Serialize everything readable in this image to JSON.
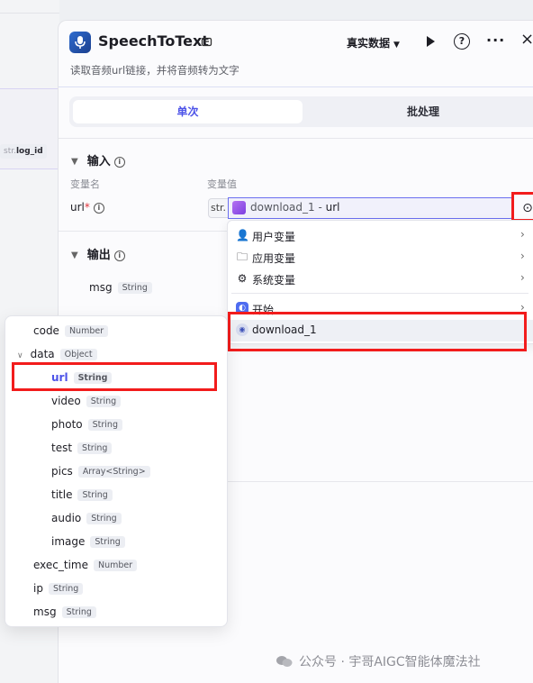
{
  "canvas": {
    "node_tag_dim": "str.",
    "node_tag_label": "log_id"
  },
  "header": {
    "title": "SpeechToText",
    "description": "读取音频url链接，并将音频转为文字",
    "env_select": "真实数据",
    "help_label": "?",
    "more_label": "···",
    "close_label": "×"
  },
  "tabs": [
    {
      "label": "单次",
      "active": true
    },
    {
      "label": "批处理",
      "active": false
    }
  ],
  "input": {
    "section_title": "输入",
    "col_name": "变量名",
    "col_value": "变量值",
    "params": [
      {
        "name": "url",
        "required_mark": "*",
        "type": "str.",
        "ref_node": "download_1",
        "ref_sep": " - ",
        "ref_field": "url"
      }
    ]
  },
  "output": {
    "section_title": "输出",
    "fields": [
      {
        "name": "msg",
        "type": "String"
      }
    ]
  },
  "variable_menu": {
    "items": [
      {
        "label": "用户变量",
        "icon": "user-icon"
      },
      {
        "label": "应用变量",
        "icon": "folder-icon"
      },
      {
        "label": "系统变量",
        "icon": "gear-icon"
      },
      {
        "label": "开始",
        "icon": "start-node-icon"
      },
      {
        "label": "download_1",
        "icon": "download-node-icon"
      }
    ]
  },
  "field_menu": {
    "items": [
      {
        "name": "code",
        "type": "Number",
        "level": 0
      },
      {
        "name": "data",
        "type": "Object",
        "level": 0,
        "expanded": true
      },
      {
        "name": "url",
        "type": "String",
        "level": 1,
        "selected": true
      },
      {
        "name": "video",
        "type": "String",
        "level": 1
      },
      {
        "name": "photo",
        "type": "String",
        "level": 1
      },
      {
        "name": "test",
        "type": "String",
        "level": 1
      },
      {
        "name": "pics",
        "type": "Array<String>",
        "level": 1
      },
      {
        "name": "title",
        "type": "String",
        "level": 1
      },
      {
        "name": "audio",
        "type": "String",
        "level": 1
      },
      {
        "name": "image",
        "type": "String",
        "level": 1
      },
      {
        "name": "exec_time",
        "type": "Number",
        "level": 0
      },
      {
        "name": "ip",
        "type": "String",
        "level": 0
      },
      {
        "name": "msg",
        "type": "String",
        "level": 0
      }
    ]
  },
  "watermark": "公众号 · 宇哥AIGC智能体魔法社",
  "colors": {
    "accent": "#4d53e8",
    "highlight_outline": "#f21c1c",
    "panel_bg": "#fbfbfd",
    "canvas_bg": "#eef0f3"
  }
}
